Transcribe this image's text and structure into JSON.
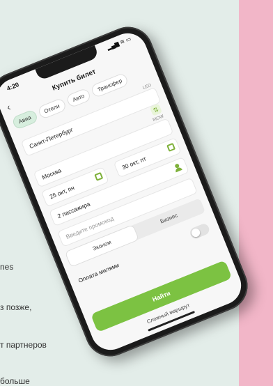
{
  "background": {
    "lines": [
      "nes",
      "з позже,",
      "т партнеров",
      "больше"
    ],
    "colors": {
      "page": "#e3ede9",
      "strip": "#f2b6c8",
      "accent": "#7cc242"
    }
  },
  "status": {
    "time": "4:20",
    "icons": "▂▄▆ ≋ ▭"
  },
  "header": {
    "title": "Купить билет",
    "back_icon": "back-arrow-icon"
  },
  "tabs": [
    {
      "label": "Авиа",
      "active": true
    },
    {
      "label": "Отели",
      "active": false
    },
    {
      "label": "Авто",
      "active": false
    },
    {
      "label": "Трансфер",
      "active": false
    }
  ],
  "form": {
    "from": {
      "value": "Санкт-Петербург",
      "tag": "LED"
    },
    "to": {
      "value": "Москва",
      "tag": "MOW"
    },
    "date_from": "25 окт, пн",
    "date_to": "30 окт, пт",
    "passengers": "2 пассажира",
    "promo_placeholder": "Введите промокод",
    "class_options": [
      {
        "label": "Эконом",
        "active": true
      },
      {
        "label": "Бизнес",
        "active": false
      }
    ],
    "miles_toggle": {
      "label": "Оплата милями",
      "on": false
    }
  },
  "actions": {
    "find_label": "Найти",
    "complex_link": "Сложный маршрут"
  }
}
